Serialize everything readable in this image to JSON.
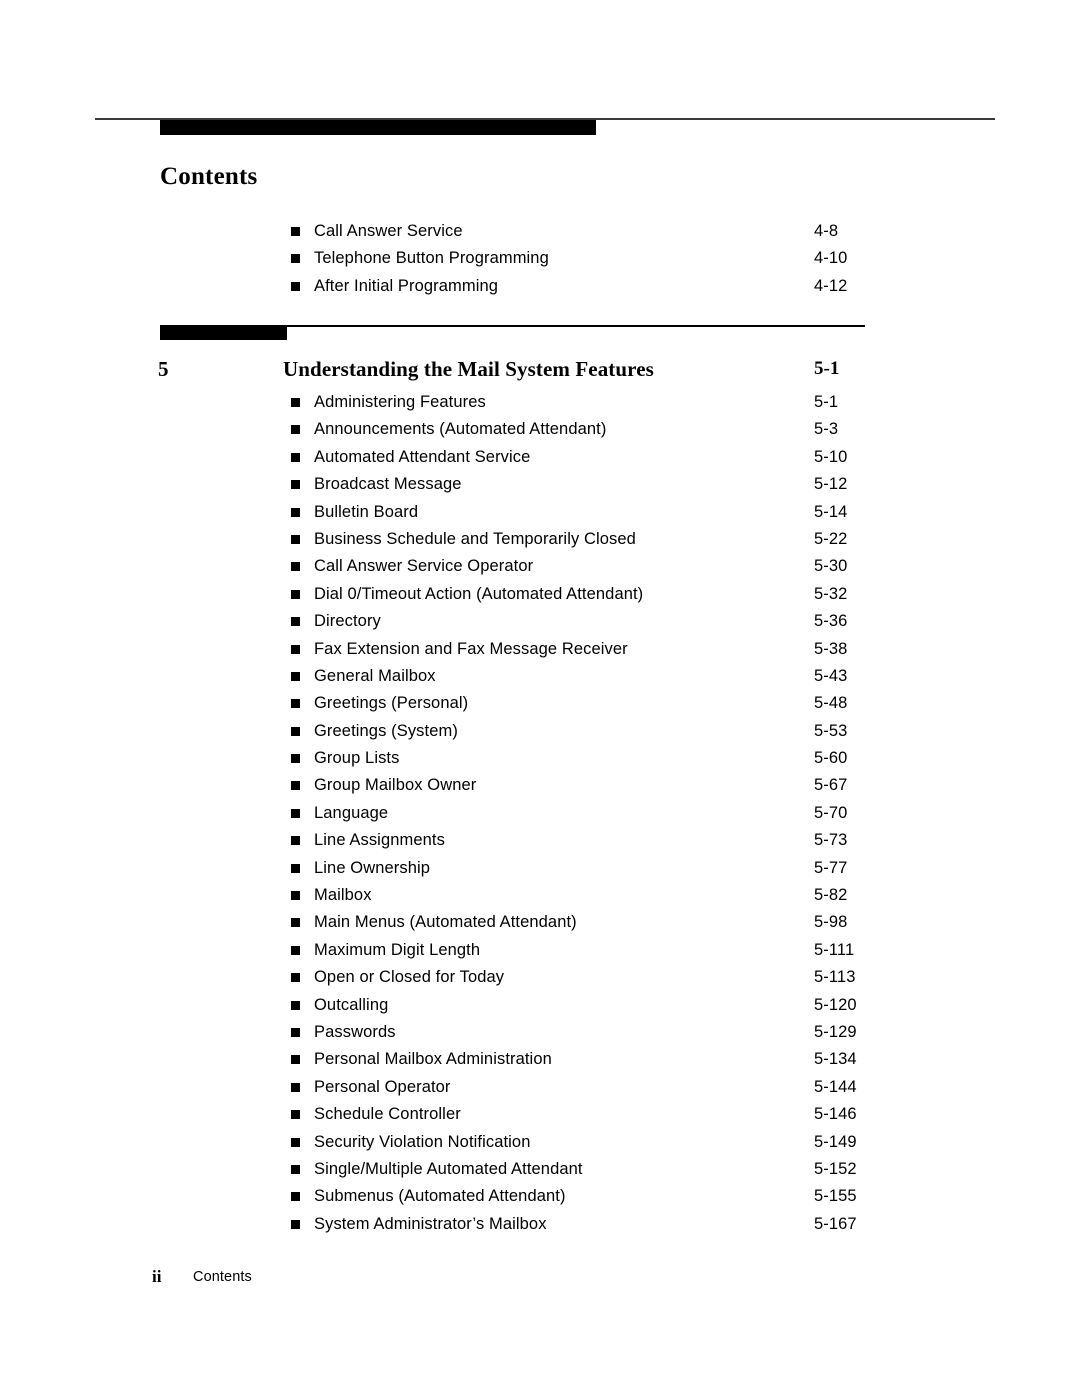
{
  "document": {
    "title": "Contents"
  },
  "top_entries": [
    {
      "label": "Call Answer Service",
      "page": "4-8"
    },
    {
      "label": "Telephone Button Programming",
      "page": "4-10"
    },
    {
      "label": "After Initial Programming",
      "page": "4-12"
    }
  ],
  "chapter": {
    "number": "5",
    "title": "Understanding the Mail System Features",
    "page": "5-1"
  },
  "chapter_entries": [
    {
      "label": "Administering Features",
      "page": "5-1"
    },
    {
      "label": "Announcements (Automated Attendant)",
      "page": "5-3"
    },
    {
      "label": "Automated Attendant Service",
      "page": "5-10"
    },
    {
      "label": "Broadcast Message",
      "page": "5-12"
    },
    {
      "label": "Bulletin Board",
      "page": "5-14"
    },
    {
      "label": "Business Schedule and Temporarily Closed",
      "page": "5-22"
    },
    {
      "label": "Call Answer Service Operator",
      "page": "5-30"
    },
    {
      "label": "Dial 0/Timeout Action (Automated Attendant)",
      "page": "5-32"
    },
    {
      "label": "Directory",
      "page": "5-36"
    },
    {
      "label": "Fax Extension and Fax Message Receiver",
      "page": "5-38"
    },
    {
      "label": "General Mailbox",
      "page": "5-43"
    },
    {
      "label": "Greetings (Personal)",
      "page": "5-48"
    },
    {
      "label": "Greetings (System)",
      "page": "5-53"
    },
    {
      "label": "Group Lists",
      "page": "5-60"
    },
    {
      "label": "Group Mailbox Owner",
      "page": "5-67"
    },
    {
      "label": "Language",
      "page": "5-70"
    },
    {
      "label": "Line Assignments",
      "page": "5-73"
    },
    {
      "label": "Line Ownership",
      "page": "5-77"
    },
    {
      "label": "Mailbox",
      "page": "5-82"
    },
    {
      "label": "Main Menus (Automated Attendant)",
      "page": "5-98"
    },
    {
      "label": "Maximum Digit Length",
      "page": "5-111"
    },
    {
      "label": "Open or Closed for Today",
      "page": "5-113"
    },
    {
      "label": "Outcalling",
      "page": "5-120"
    },
    {
      "label": "Passwords",
      "page": "5-129"
    },
    {
      "label": "Personal Mailbox Administration",
      "page": "5-134"
    },
    {
      "label": "Personal Operator",
      "page": "5-144"
    },
    {
      "label": "Schedule Controller",
      "page": "5-146"
    },
    {
      "label": "Security Violation Notification",
      "page": "5-149"
    },
    {
      "label": "Single/Multiple Automated Attendant",
      "page": "5-152"
    },
    {
      "label": "Submenus (Automated Attendant)",
      "page": "5-155"
    },
    {
      "label": "System Administrator’s Mailbox",
      "page": "5-167"
    }
  ],
  "footer": {
    "folio": "ii",
    "label": "Contents"
  },
  "colors": {
    "ink": "#000000",
    "paper": "#ffffff",
    "rule": "#3a3a3a"
  }
}
